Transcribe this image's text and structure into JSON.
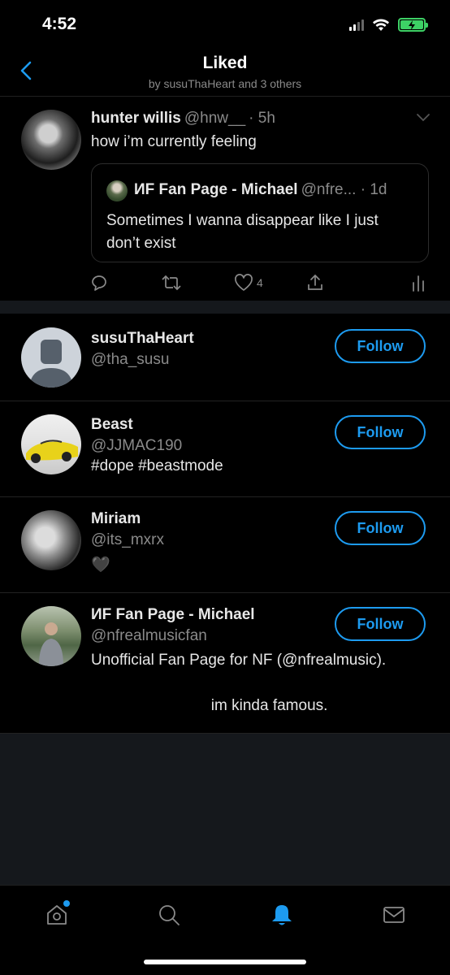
{
  "status": {
    "time": "4:52",
    "battery_color": "#3dd165"
  },
  "header": {
    "title": "Liked",
    "subtitle": "by susuThaHeart and 3 others"
  },
  "tweet": {
    "name": "hunter willis",
    "handle": "@hnw__",
    "time": "· 5h",
    "text": "how i’m currently feeling",
    "quote": {
      "name": "ИF Fan Page - Michael",
      "handle": "@nfre... · 1d",
      "text": "Sometimes I wanna disappear like I just don’t exist"
    },
    "actions": {
      "like_count": "4"
    }
  },
  "users": [
    {
      "name": "susuThaHeart",
      "handle": "@tha_susu",
      "bio": "",
      "follow_label": "Follow"
    },
    {
      "name": "Beast",
      "handle": "@JJMAC190",
      "bio": "#dope #beastmode",
      "follow_label": "Follow"
    },
    {
      "name": "Miriam",
      "handle": "@its_mxrx",
      "bio": "🖤",
      "follow_label": "Follow"
    },
    {
      "name": "ИF Fan Page - Michael",
      "handle": "@nfrealmusicfan",
      "bio": "Unofficial Fan Page for NF (@nfrealmusic).\n\n                            im kinda famous.",
      "follow_label": "Follow"
    }
  ],
  "colors": {
    "accent": "#1d9bf0",
    "background": "#000000",
    "secondary_text": "#8a8a8a"
  },
  "tabs": [
    "home-icon",
    "search-icon",
    "notifications-icon",
    "messages-icon"
  ]
}
